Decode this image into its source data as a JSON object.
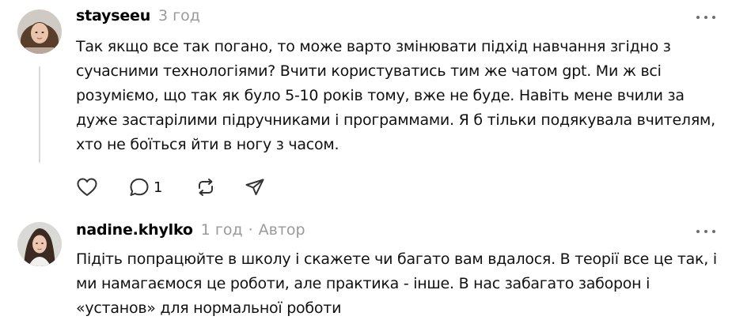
{
  "comments": [
    {
      "username": "stayseeu",
      "time": "3 год",
      "text": "Так якщо все так погано, то може варто змінювати підхід навчання згідно з сучасними технологіями? Вчити користуватись тим же чатом gpt. Ми ж всі розуміємо, що так як було 5-10 років тому, вже не буде. Навіть мене вчили за дуже застарілими підручниками і программами. Я б тільки подякувала вчителям, хто не боїться йти в ногу з часом.",
      "reply_count": "1"
    },
    {
      "username": "nadine.khylko",
      "time": "1 год",
      "author_label": "Автор",
      "text": "Підіть попрацюйте в школу і скажете чи багато вам вдалося. В теорії все це так, і ми намагаємося це роботи, але практика - інше. В нас забагато заборон і «установ» для нормальної роботи"
    }
  ],
  "icons": {
    "like": "heart-icon",
    "reply": "speech-bubble-icon",
    "repost": "repost-icon",
    "share": "paper-plane-icon",
    "more": "more-horizontal-icon"
  },
  "colors": {
    "text": "#111111",
    "muted": "#9a9a9a",
    "icon": "#333333",
    "thread_line": "#d9d9d9"
  }
}
